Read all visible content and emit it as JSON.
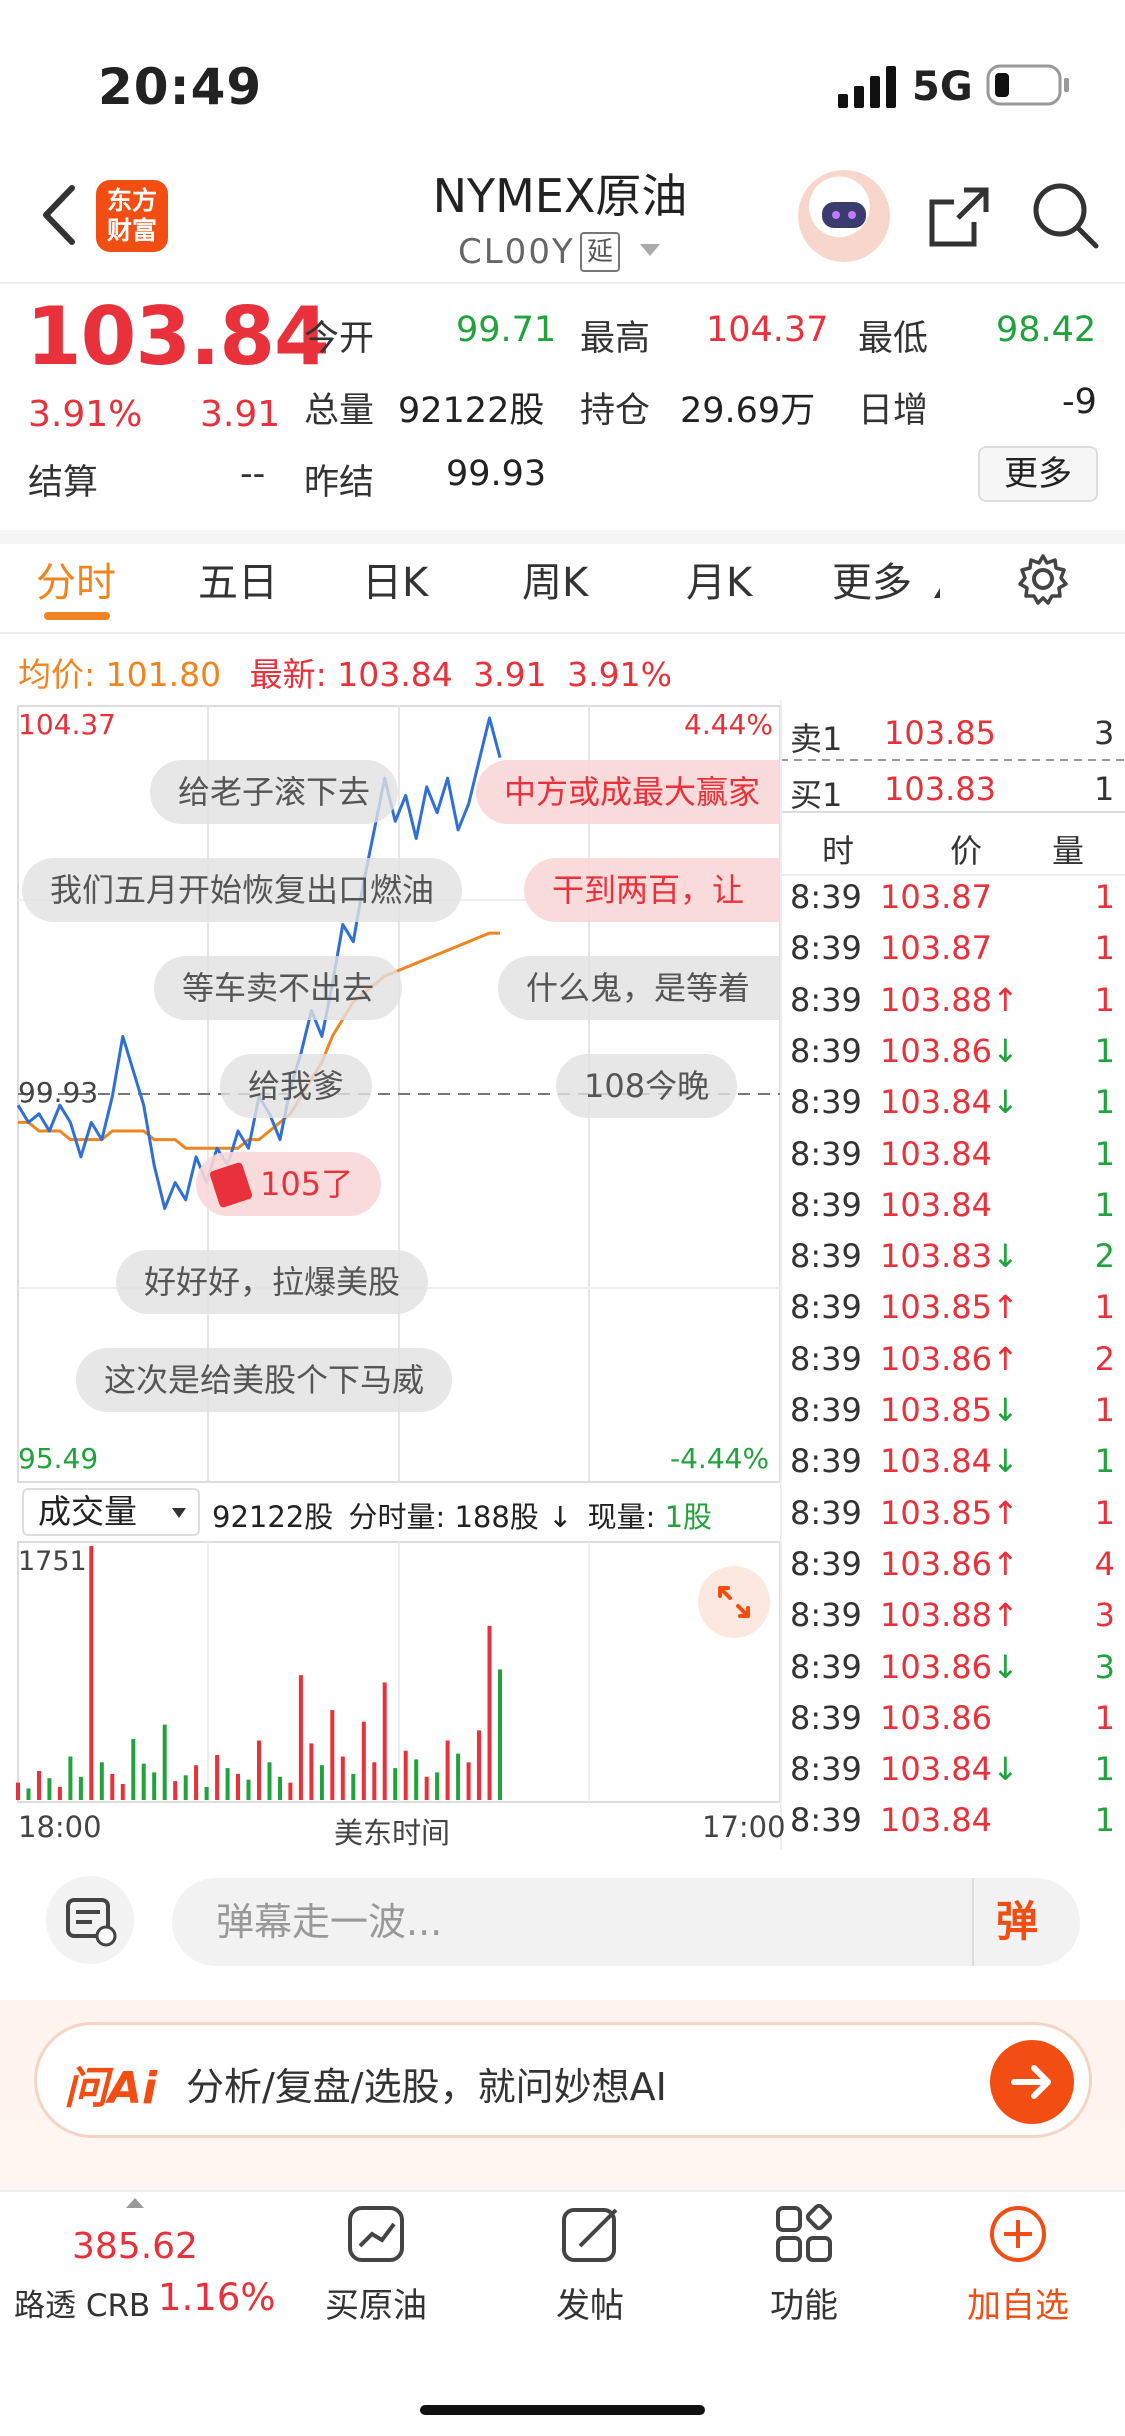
{
  "status_bar": {
    "time": "20:49",
    "network": "5G"
  },
  "header": {
    "logo_text": "东方财富",
    "instrument_name": "NYMEX原油",
    "instrument_code": "CL00Y",
    "delay_tag": "延"
  },
  "quote": {
    "price": "103.84",
    "change_pct": "3.91%",
    "change": "3.91",
    "open_label": "今开",
    "open": "99.71",
    "high_label": "最高",
    "high": "104.37",
    "low_label": "最低",
    "low": "98.42",
    "volume_label": "总量",
    "volume": "92122股",
    "oi_label": "持仓",
    "open_interest": "29.69万",
    "daily_inc_label": "日增",
    "daily_inc": "-9",
    "settle_label": "结算",
    "settle": "--",
    "prev_settle_label": "昨结",
    "prev_settle": "99.93",
    "more_label": "更多"
  },
  "tabs": [
    {
      "label": "分时",
      "active": true
    },
    {
      "label": "五日"
    },
    {
      "label": "日K"
    },
    {
      "label": "周K"
    },
    {
      "label": "月K"
    },
    {
      "label": "更多"
    }
  ],
  "avg_line": {
    "avg_label": "均价:",
    "avg": "101.80",
    "latest_label": "最新:",
    "latest": "103.84",
    "chg": "3.91",
    "pct": "3.91%"
  },
  "chart_data": {
    "type": "line",
    "y_top": "104.37",
    "y_mid": "99.93",
    "y_bottom": "95.49",
    "pct_top": "4.44%",
    "pct_bottom": "-4.44%",
    "ylim": [
      95.49,
      104.37
    ],
    "reference": 99.93,
    "x_start": "18:00",
    "x_mid": "美东时间",
    "x_end": "17:00",
    "price_series": [
      99.8,
      99.6,
      99.7,
      99.5,
      99.8,
      99.6,
      99.2,
      99.6,
      99.4,
      99.9,
      100.6,
      100.2,
      99.8,
      99.1,
      98.6,
      98.9,
      98.7,
      99.2,
      98.9,
      99.3,
      99.1,
      99.5,
      99.3,
      99.9,
      99.7,
      99.4,
      100.0,
      100.4,
      100.9,
      100.6,
      101.2,
      101.9,
      101.7,
      102.4,
      103.0,
      103.6,
      103.1,
      103.4,
      102.9,
      103.5,
      103.2,
      103.6,
      103.0,
      103.3,
      103.8,
      104.3,
      103.84
    ],
    "avg_series": [
      99.6,
      99.6,
      99.5,
      99.5,
      99.5,
      99.4,
      99.4,
      99.4,
      99.4,
      99.5,
      99.5,
      99.5,
      99.5,
      99.4,
      99.4,
      99.4,
      99.3,
      99.3,
      99.3,
      99.3,
      99.3,
      99.3,
      99.4,
      99.4,
      99.5,
      99.6,
      99.7,
      99.9,
      100.1,
      100.3,
      100.6,
      100.8,
      101.0,
      101.1,
      101.2,
      101.3,
      101.35,
      101.4,
      101.45,
      101.5,
      101.55,
      101.6,
      101.65,
      101.7,
      101.75,
      101.8,
      101.8
    ],
    "volume_max": "1751",
    "volume_series": [
      120,
      80,
      200,
      150,
      90,
      300,
      160,
      1751,
      260,
      180,
      110,
      420,
      250,
      190,
      520,
      130,
      170,
      240,
      90,
      310,
      220,
      180,
      140,
      410,
      260,
      160,
      120,
      860,
      390,
      240,
      620,
      300,
      180,
      540,
      260,
      810,
      220,
      340,
      280,
      160,
      190,
      410,
      320,
      260,
      480,
      1200,
      900
    ]
  },
  "danmaku": [
    {
      "text": "给老子滚下去"
    },
    {
      "text": "中方或成最大赢家",
      "highlight": true
    },
    {
      "text": "我们五月开始恢复出口燃油"
    },
    {
      "text": "干到两百，让",
      "highlight": true
    },
    {
      "text": "等车卖不出去"
    },
    {
      "text": "什么鬼，是等着"
    },
    {
      "text": "给我爹"
    },
    {
      "text": "108今晚"
    },
    {
      "text": "105了",
      "highlight": true
    },
    {
      "text": "好好好，拉爆美股"
    },
    {
      "text": "这次是给美股个下马威"
    }
  ],
  "order_book": {
    "sell1_label": "卖1",
    "sell1_price": "103.85",
    "sell1_qty": "3",
    "buy1_label": "买1",
    "buy1_price": "103.83",
    "buy1_qty": "1",
    "col_time": "时",
    "col_price": "价",
    "col_qty": "量"
  },
  "trades": [
    {
      "time": "8:39",
      "price": "103.87",
      "dir": "",
      "qty": "1",
      "side": "red"
    },
    {
      "time": "8:39",
      "price": "103.87",
      "dir": "",
      "qty": "1",
      "side": "red"
    },
    {
      "time": "8:39",
      "price": "103.88↑",
      "dir": "up",
      "qty": "1",
      "side": "red"
    },
    {
      "time": "8:39",
      "price": "103.86↓",
      "dir": "down",
      "qty": "1",
      "side": "green"
    },
    {
      "time": "8:39",
      "price": "103.84↓",
      "dir": "down",
      "qty": "1",
      "side": "green"
    },
    {
      "time": "8:39",
      "price": "103.84",
      "dir": "",
      "qty": "1",
      "side": "green"
    },
    {
      "time": "8:39",
      "price": "103.84",
      "dir": "",
      "qty": "1",
      "side": "green"
    },
    {
      "time": "8:39",
      "price": "103.83↓",
      "dir": "down",
      "qty": "2",
      "side": "green"
    },
    {
      "time": "8:39",
      "price": "103.85↑",
      "dir": "up",
      "qty": "1",
      "side": "red"
    },
    {
      "time": "8:39",
      "price": "103.86↑",
      "dir": "up",
      "qty": "2",
      "side": "red"
    },
    {
      "time": "8:39",
      "price": "103.85↓",
      "dir": "down",
      "qty": "1",
      "side": "red"
    },
    {
      "time": "8:39",
      "price": "103.84↓",
      "dir": "down",
      "qty": "1",
      "side": "green"
    },
    {
      "time": "8:39",
      "price": "103.85↑",
      "dir": "up",
      "qty": "1",
      "side": "red"
    },
    {
      "time": "8:39",
      "price": "103.86↑",
      "dir": "up",
      "qty": "4",
      "side": "red"
    },
    {
      "time": "8:39",
      "price": "103.88↑",
      "dir": "up",
      "qty": "3",
      "side": "red"
    },
    {
      "time": "8:39",
      "price": "103.86↓",
      "dir": "down",
      "qty": "3",
      "side": "green"
    },
    {
      "time": "8:39",
      "price": "103.86",
      "dir": "",
      "qty": "1",
      "side": "red"
    },
    {
      "time": "8:39",
      "price": "103.84↓",
      "dir": "down",
      "qty": "1",
      "side": "green"
    },
    {
      "time": "8:39",
      "price": "103.84",
      "dir": "",
      "qty": "1",
      "side": "green"
    }
  ],
  "volume_bar": {
    "selector_label": "成交量",
    "total": "92122股",
    "period_label": "分时量:",
    "period_volume": "188股",
    "arrow": "↓",
    "current_label": "现量:",
    "current_volume": "1股"
  },
  "comment_bar": {
    "placeholder": "弹幕走一波...",
    "toggle_label": "弹"
  },
  "ai_bar": {
    "logo": "问Ai",
    "text": "分析/复盘/选股，就问妙想AI"
  },
  "bottom_nav": {
    "index_value": "385.62",
    "index_name": "路透 CRB",
    "index_pct": "1.16%",
    "items": [
      {
        "label": "买原油"
      },
      {
        "label": "发帖"
      },
      {
        "label": "功能"
      },
      {
        "label": "加自选"
      }
    ]
  },
  "colors": {
    "up": "#e8313a",
    "down": "#1fa33a",
    "accent": "#f0851f",
    "brand": "#f24e14",
    "price_line": "#2f6fd6"
  }
}
